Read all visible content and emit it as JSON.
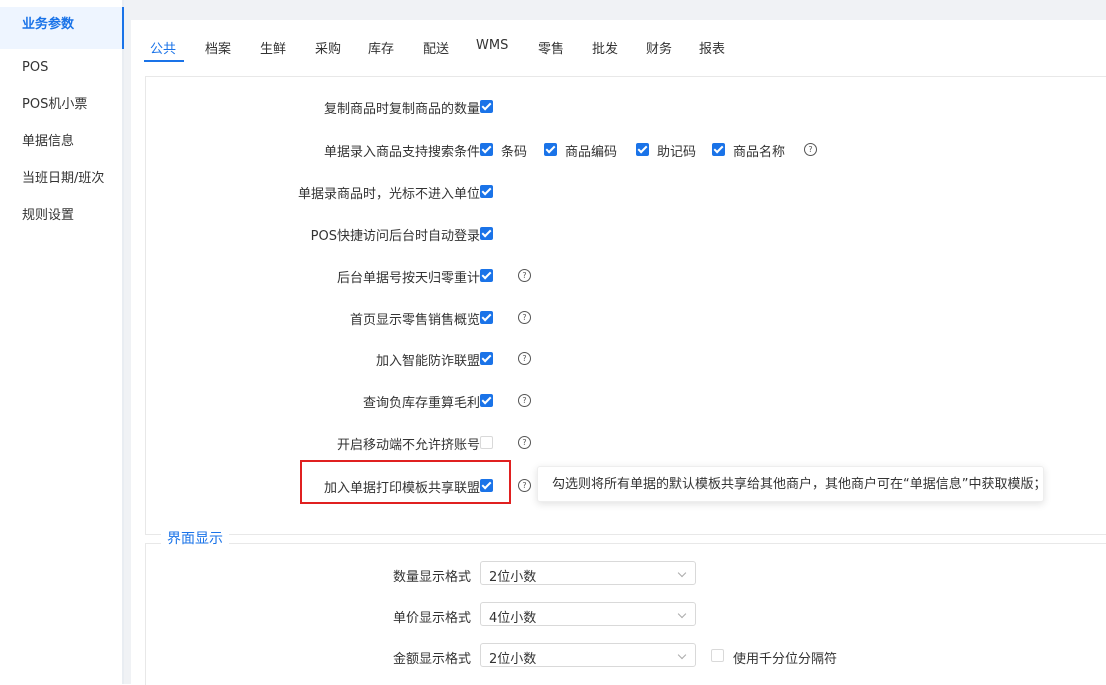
{
  "sidebar": {
    "items": [
      {
        "label": "业务参数",
        "active": true
      },
      {
        "label": "POS"
      },
      {
        "label": "POS机小票"
      },
      {
        "label": "单据信息"
      },
      {
        "label": "当班日期/班次"
      },
      {
        "label": "规则设置"
      }
    ]
  },
  "tabs": [
    "公共",
    "档案",
    "生鲜",
    "采购",
    "库存",
    "配送",
    "WMS",
    "零售",
    "批发",
    "财务",
    "报表"
  ],
  "settings": {
    "copy_qty": {
      "label": "复制商品时复制商品的数量",
      "checked": true
    },
    "search_cond": {
      "label": "单据录入商品支持搜索条件",
      "options": [
        {
          "label": "条码",
          "checked": true
        },
        {
          "label": "商品编码",
          "checked": true
        },
        {
          "label": "助记码",
          "checked": true
        },
        {
          "label": "商品名称",
          "checked": true
        }
      ]
    },
    "cursor_unit": {
      "label": "单据录商品时，光标不进入单位",
      "checked": true
    },
    "pos_autologin": {
      "label": "POS快捷访问后台时自动登录",
      "checked": true
    },
    "daily_reset": {
      "label": "后台单据号按天归零重计",
      "checked": true
    },
    "home_sales": {
      "label": "首页显示零售销售概览",
      "checked": true
    },
    "anti_fraud": {
      "label": "加入智能防诈联盟",
      "checked": true
    },
    "neg_stock": {
      "label": "查询负库存重算毛利",
      "checked": true
    },
    "mobile_multi": {
      "label": "开启移动端不允许挤账号",
      "checked": false
    },
    "print_share": {
      "label": "加入单据打印模板共享联盟",
      "checked": true
    }
  },
  "tooltip": "勾选则将所有单据的默认模板共享给其他商户，其他商户可在“单据信息”中获取模版；",
  "help_glyph": "?",
  "display_section": {
    "title": "界面显示",
    "qty_format": {
      "label": "数量显示格式",
      "value": "2位小数"
    },
    "price_format": {
      "label": "单价显示格式",
      "value": "4位小数"
    },
    "amount_format": {
      "label": "金额显示格式",
      "value": "2位小数"
    },
    "thousand_sep": {
      "label": "使用千分位分隔符",
      "checked": false
    }
  },
  "colors": {
    "accent": "#1a73e8",
    "highlight": "#e02020"
  }
}
